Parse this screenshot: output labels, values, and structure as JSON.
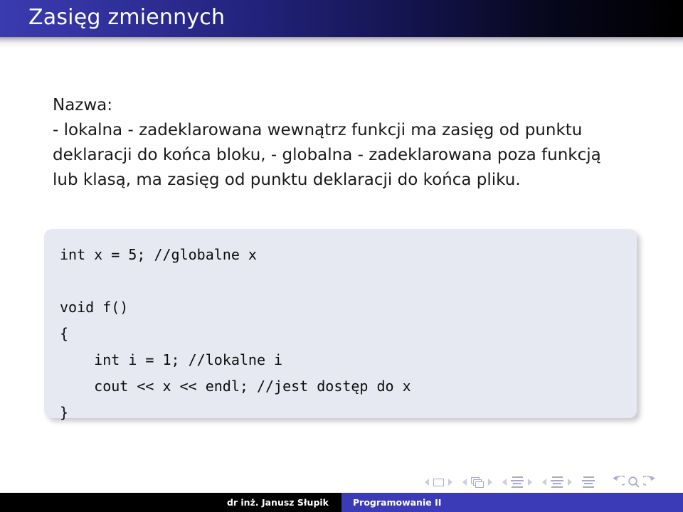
{
  "slide": {
    "title": "Zasięg zmiennych",
    "heading": "Nazwa:",
    "body": "- lokalna - zadeklarowana wewnątrz funkcji ma zasięg od punktu deklaracji do końca bloku, - globalna - zadeklarowana poza funkcją lub klasą, ma zasięg od punktu deklaracji do końca pliku.",
    "code": "int x = 5; //globalne x\n\nvoid f()\n{\n    int i = 1; //lokalne i\n    cout << x << endl; //jest dostęp do x\n}"
  },
  "navigation": {
    "items": [
      {
        "name": "slide-nav",
        "prev": "◀",
        "symbol": "slide-icon",
        "next": "▶"
      },
      {
        "name": "frame-nav",
        "prev": "◀",
        "symbol": "frames-icon",
        "next": "▶"
      },
      {
        "name": "subsection-nav",
        "prev": "◀",
        "symbol": "subsection-icon",
        "next": "▶"
      },
      {
        "name": "section-nav",
        "prev": "◀",
        "symbol": "section-icon",
        "next": "▶"
      }
    ],
    "presentation_symbol": "presentation-icon",
    "back_label": "back",
    "search_label": "search",
    "forward_label": "forward"
  },
  "footer": {
    "author": "dr inż. Janusz Słupik",
    "subject": "Programowanie II"
  },
  "colors": {
    "title_bar_start": "#3b3bb0",
    "title_bar_end": "#000000",
    "footer_left_bg": "#000000",
    "footer_right_bg": "#3b3bb8",
    "code_bg": "#e7e9f2",
    "nav_symbol": "#a5a9cc"
  }
}
